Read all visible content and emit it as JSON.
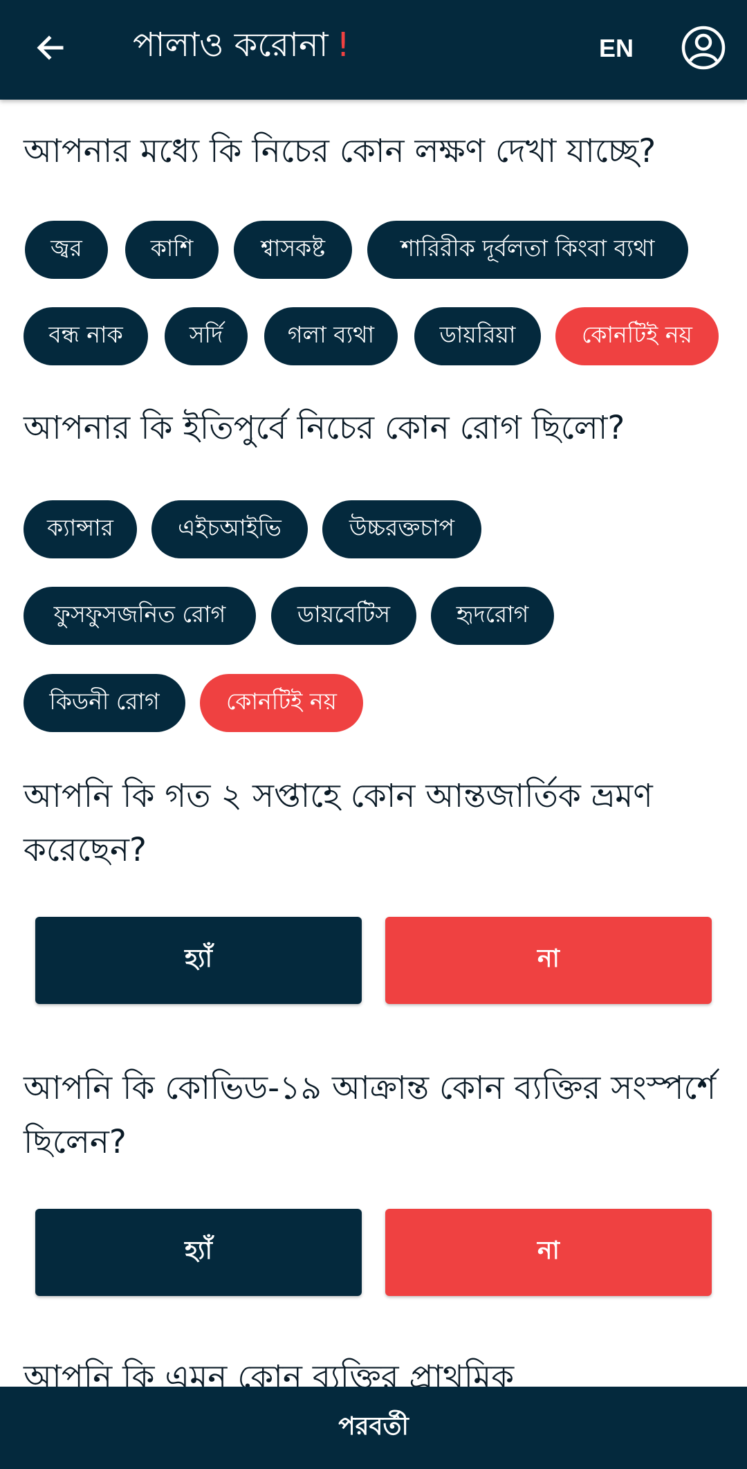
{
  "header": {
    "title": "পালাও করোনা",
    "title_mark": "!",
    "lang": "EN"
  },
  "questions": [
    {
      "text": "আপনার মধ্যে কি নিচের কোন লক্ষণ দেখা যাচ্ছে?",
      "chips": [
        "জ্বর",
        "কাশি",
        "শ্বাসকষ্ট",
        "শারিরীক দূর্বলতা কিংবা ব্যথা",
        "বন্ধ নাক",
        "সর্দি",
        "গলা ব্যথা",
        "ডায়রিয়া",
        "কোনটিই নয়"
      ]
    },
    {
      "text": "আপনার কি ইতিপুর্বে নিচের কোন রোগ ছিলো?",
      "chips": [
        "ক্যান্সার",
        "এইচআইভি",
        "উচ্চরক্তচাপ",
        "ফুসফুসজনিত রোগ",
        "ডায়বেটিস",
        "হৃদরোগ",
        "কিডনী রোগ",
        "কোনটিই নয়"
      ]
    },
    {
      "text": "আপনি কি গত ২ সপ্তাহে কোন আন্তজার্তিক ভ্রমণ করেছেন?",
      "yes": "হ্যাঁ",
      "no": "না"
    },
    {
      "text": "আপনি কি কোভিড-১৯ আক্রান্ত কোন ব্যক্তির সংস্পর্শে ছিলেন?",
      "yes": "হ্যাঁ",
      "no": "না"
    },
    {
      "text": "আপনি কি এমন কোন ব্যক্তির প্রাথমিক"
    }
  ],
  "footer": {
    "next": "পরবর্তী"
  },
  "colors": {
    "navy": "#04293d",
    "red": "#ef4141"
  }
}
